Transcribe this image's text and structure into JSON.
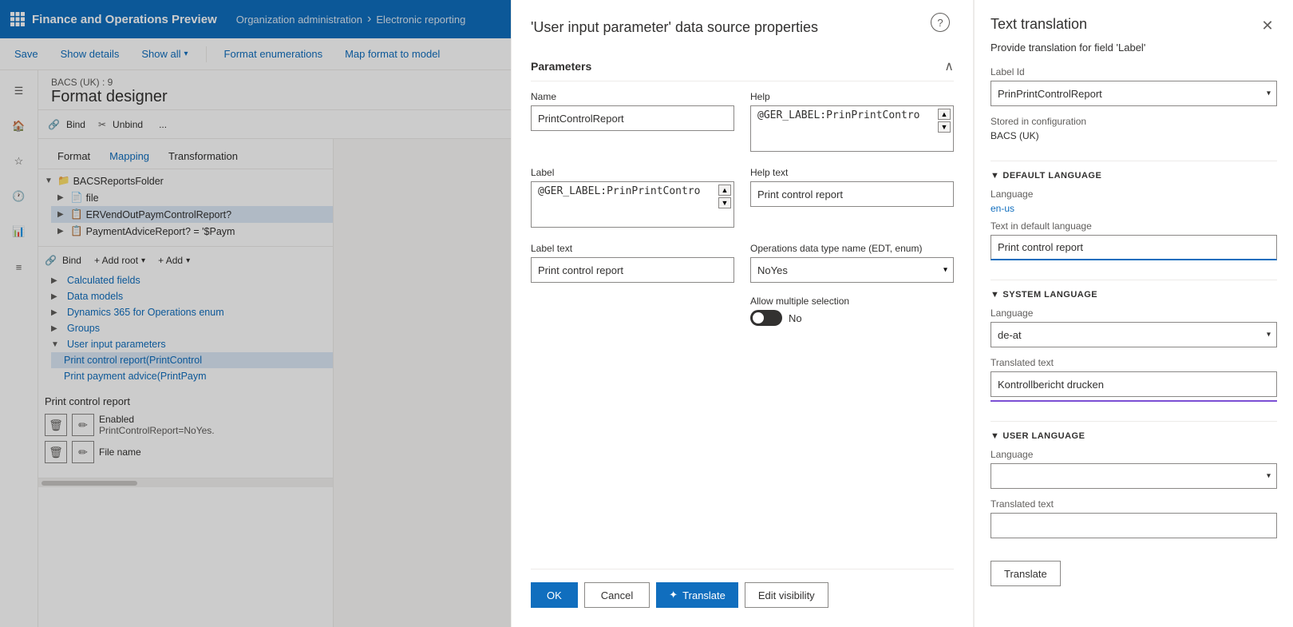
{
  "app": {
    "title": "Finance and Operations Preview",
    "grid_icon": "grid-icon",
    "breadcrumb": [
      "Organization administration",
      "Electronic reporting"
    ]
  },
  "toolbar": {
    "save_label": "Save",
    "show_details_label": "Show details",
    "show_all_label": "Show all",
    "format_enumerations_label": "Format enumerations",
    "map_format_to_model_label": "Map format to model"
  },
  "left_nav": {
    "icons": [
      "home-icon",
      "star-icon",
      "clock-icon",
      "chart-icon",
      "list-icon"
    ]
  },
  "page": {
    "subtitle": "BACS (UK) : 9",
    "title": "Format designer"
  },
  "format_toolbar": {
    "bind_label": "Bind",
    "unbind_label": "Unbind",
    "more_label": "..."
  },
  "format_tabs": {
    "tabs": [
      "Format",
      "Mapping",
      "Transformation"
    ],
    "active": 1
  },
  "right_toolbar": {
    "bind_label": "Bind",
    "add_root_label": "+ Add root",
    "add_label": "+ Add"
  },
  "tree": {
    "items": [
      {
        "label": "BACSReportsFolder",
        "level": 0,
        "expanded": true,
        "icon": "folder"
      },
      {
        "label": "file",
        "level": 1,
        "expanded": false,
        "icon": "file"
      },
      {
        "label": "ERVendOutPaymControlReport?",
        "level": 1,
        "expanded": false,
        "icon": "report",
        "selected": true
      },
      {
        "label": "PaymentAdviceReport? = '$Paym",
        "level": 1,
        "expanded": false,
        "icon": "report"
      }
    ]
  },
  "data_sources": {
    "sections": [
      {
        "label": "Calculated fields",
        "expanded": false
      },
      {
        "label": "Data models",
        "expanded": false
      },
      {
        "label": "Dynamics 365 for Operations enum",
        "expanded": false
      },
      {
        "label": "Groups",
        "expanded": false
      }
    ],
    "user_input_params": {
      "label": "User input parameters",
      "expanded": true,
      "items": [
        {
          "label": "Print control report(PrintControl",
          "active": true
        },
        {
          "label": "Print payment advice(PrintPaym",
          "active": false
        }
      ]
    }
  },
  "print_control": {
    "title": "Print control report",
    "enabled_label": "Enabled",
    "enabled_value": "PrintControlReport=NoYes.",
    "file_name_label": "File name"
  },
  "modal": {
    "title": "'User input parameter' data source properties",
    "parameters_section": "Parameters",
    "name_label": "Name",
    "name_value": "PrintControlReport",
    "label_label": "Label",
    "label_value": "@GER_LABEL:PrinPrintContro",
    "label_text_label": "Label text",
    "label_text_value": "Print control report",
    "help_label": "Help",
    "help_value": "@GER_LABEL:PrinPrintContro",
    "help_text_label": "Help text",
    "help_text_value": "Print control report",
    "operations_label": "Operations data type name (EDT, enum)",
    "operations_value": "NoYes",
    "allow_multiple_label": "Allow multiple selection",
    "toggle_value": "No",
    "toggle_state": "off",
    "ok_label": "OK",
    "cancel_label": "Cancel",
    "translate_label": "Translate",
    "edit_visibility_label": "Edit visibility"
  },
  "translation_panel": {
    "title": "Text translation",
    "subtitle": "Provide translation for field 'Label'",
    "label_id_label": "Label Id",
    "label_id_value": "PrinPrintControlReport",
    "stored_in_label": "Stored in configuration",
    "stored_in_value": "BACS (UK)",
    "default_language_section": "DEFAULT LANGUAGE",
    "default_lang_label": "Language",
    "default_lang_value": "en-us",
    "text_default_label": "Text in default language",
    "text_default_value": "Print control report",
    "system_language_section": "SYSTEM LANGUAGE",
    "system_lang_label": "Language",
    "system_lang_value": "de-at",
    "translated_text_label": "Translated text",
    "translated_text_value": "Kontrollbericht drucken",
    "user_language_section": "USER LANGUAGE",
    "user_lang_label": "Language",
    "user_lang_value": "",
    "user_translated_label": "Translated text",
    "user_translated_value": "",
    "translate_btn_label": "Translate",
    "close_icon": "close-icon"
  }
}
